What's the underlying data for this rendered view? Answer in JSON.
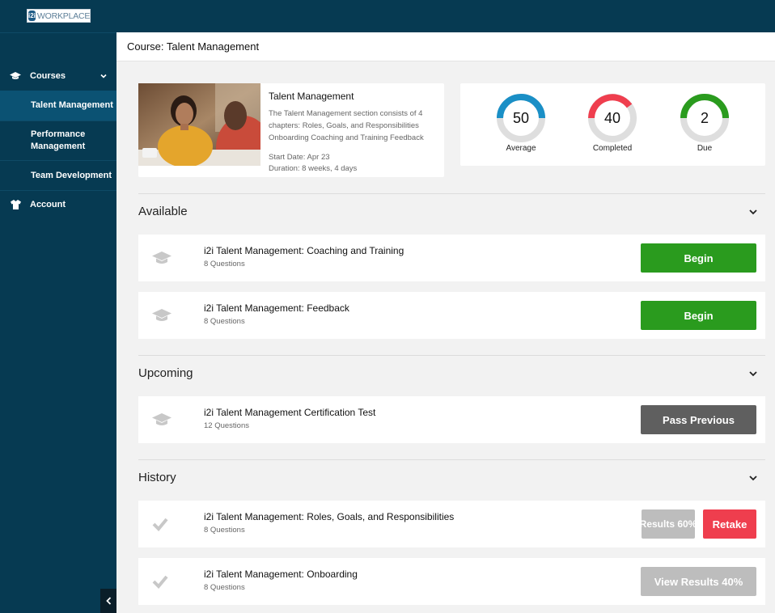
{
  "brand": {
    "logo_badge": "i2i",
    "logo_text": "WORKPLACE"
  },
  "sidebar": {
    "courses_label": "Courses",
    "sub_items": [
      {
        "label": "Talent Management",
        "active": true
      },
      {
        "label": "Performance\nManagement",
        "active": false
      },
      {
        "label": "Team Development",
        "active": false
      }
    ],
    "account_label": "Account"
  },
  "header": {
    "title": "Course: Talent Management"
  },
  "course": {
    "name": "Talent Management",
    "description": "The Talent Management section consists of 4 chapters: Roles, Goals, and Responsibilities Onboarding Coaching and Training Feedback",
    "start_date": "Start Date: Apr 23",
    "duration": "Duration: 8 weeks, 4 days"
  },
  "stats": [
    {
      "value": "50",
      "label": "Average",
      "color": "#1a8fc6"
    },
    {
      "value": "40",
      "label": "Completed",
      "color": "#ef3e4e"
    },
    {
      "value": "2",
      "label": "Due",
      "color": "#2a9b1e"
    }
  ],
  "sections": {
    "available": {
      "title": "Available",
      "items": [
        {
          "title": "i2i Talent Management: Coaching and Training",
          "subtitle": "8 Questions",
          "button": "Begin"
        },
        {
          "title": "i2i Talent Management: Feedback",
          "subtitle": "8 Questions",
          "button": "Begin"
        }
      ]
    },
    "upcoming": {
      "title": "Upcoming",
      "items": [
        {
          "title": "i2i Talent Management Certification Test",
          "subtitle": "12 Questions",
          "button": "Pass Previous"
        }
      ]
    },
    "history": {
      "title": "History",
      "items": [
        {
          "title": "i2i Talent Management: Roles, Goals, and Responsibilities",
          "subtitle": "8 Questions",
          "results_button": "Results 60%",
          "retake_button": "Retake"
        },
        {
          "title": "i2i Talent Management: Onboarding",
          "subtitle": "8 Questions",
          "results_button": "View Results 40%"
        }
      ]
    }
  },
  "colors": {
    "nav_bg": "#063a52",
    "nav_active": "#0b5273",
    "accent_green": "#2a9b1e",
    "accent_red": "#ef3e4e",
    "accent_blue": "#1a8fc6"
  }
}
